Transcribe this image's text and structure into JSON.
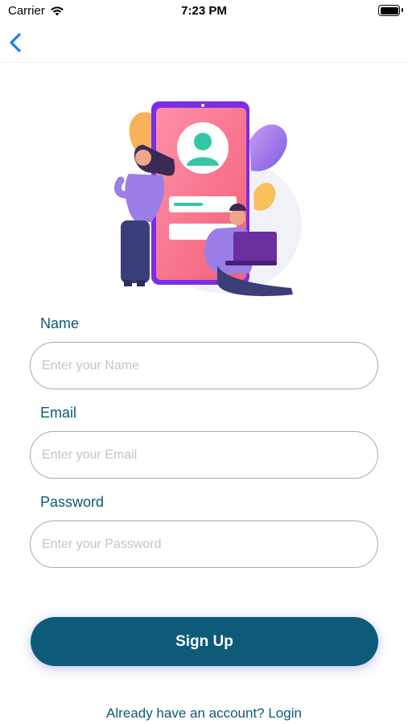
{
  "status_bar": {
    "carrier": "Carrier",
    "time": "7:23 PM"
  },
  "nav": {
    "back_icon": "chevron-left-icon"
  },
  "form": {
    "name": {
      "label": "Name",
      "placeholder": "Enter your Name",
      "value": ""
    },
    "email": {
      "label": "Email",
      "placeholder": "Enter your Email",
      "value": ""
    },
    "password": {
      "label": "Password",
      "placeholder": "Enter your Password",
      "value": ""
    }
  },
  "actions": {
    "signup_label": "Sign Up",
    "login_prompt": "Already have an account? Login"
  },
  "colors": {
    "accent": "#0d5b79",
    "label": "#0b5975",
    "back_icon": "#1a7ff0"
  }
}
